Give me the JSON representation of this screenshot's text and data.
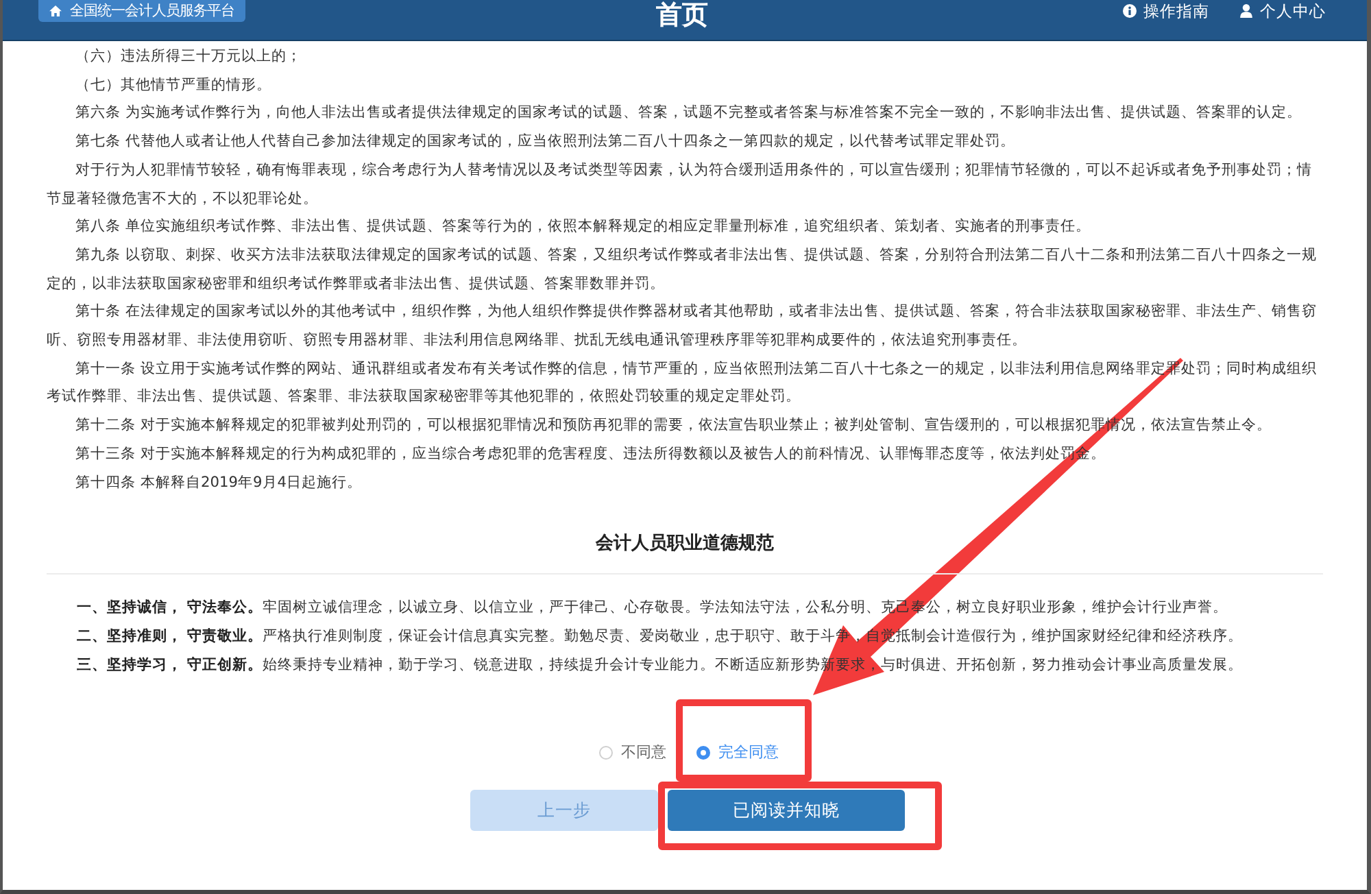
{
  "header": {
    "platform": "全国统一会计人员服务平台",
    "title": "首页",
    "links": [
      {
        "label": "操作指南",
        "kind": "guide"
      },
      {
        "label": "个人中心",
        "kind": "account"
      }
    ]
  },
  "interpretation": {
    "paragraphs": [
      "（六）违法所得三十万元以上的；",
      "（七）其他情节严重的情形。",
      "第六条 为实施考试作弊行为，向他人非法出售或者提供法律规定的国家考试的试题、答案，试题不完整或者答案与标准答案不完全一致的，不影响非法出售、提供试题、答案罪的认定。",
      "第七条 代替他人或者让他人代替自己参加法律规定的国家考试的，应当依照刑法第二百八十四条之一第四款的规定，以代替考试罪定罪处罚。",
      "对于行为人犯罪情节较轻，确有悔罪表现，综合考虑行为人替考情况以及考试类型等因素，认为符合缓刑适用条件的，可以宣告缓刑；犯罪情节轻微的，可以不起诉或者免予刑事处罚；情节显著轻微危害不大的，不以犯罪论处。",
      "第八条 单位实施组织考试作弊、非法出售、提供试题、答案等行为的，依照本解释规定的相应定罪量刑标准，追究组织者、策划者、实施者的刑事责任。",
      "第九条 以窃取、刺探、收买方法非法获取法律规定的国家考试的试题、答案，又组织考试作弊或者非法出售、提供试题、答案，分别符合刑法第二百八十二条和刑法第二百八十四条之一规定的，以非法获取国家秘密罪和组织考试作弊罪或者非法出售、提供试题、答案罪数罪并罚。",
      "第十条 在法律规定的国家考试以外的其他考试中，组织作弊，为他人组织作弊提供作弊器材或者其他帮助，或者非法出售、提供试题、答案，符合非法获取国家秘密罪、非法生产、销售窃听、窃照专用器材罪、非法使用窃听、窃照专用器材罪、非法利用信息网络罪、扰乱无线电通讯管理秩序罪等犯罪构成要件的，依法追究刑事责任。",
      "第十一条 设立用于实施考试作弊的网站、通讯群组或者发布有关考试作弊的信息，情节严重的，应当依照刑法第二百八十七条之一的规定，以非法利用信息网络罪定罪处罚；同时构成组织考试作弊罪、非法出售、提供试题、答案罪、非法获取国家秘密罪等其他犯罪的，依照处罚较重的规定定罪处罚。",
      "第十二条 对于实施本解释规定的犯罪被判处刑罚的，可以根据犯罪情况和预防再犯罪的需要，依法宣告职业禁止；被判处管制、宣告缓刑的，可以根据犯罪情况，依法宣告禁止令。",
      "第十三条 对于实施本解释规定的行为构成犯罪的，应当综合考虑犯罪的危害程度、违法所得数额以及被告人的前科情况、认罪悔罪态度等，依法判处罚金。",
      "第十四条 本解释自2019年9月4日起施行。"
    ]
  },
  "code_of_ethics": {
    "title": "会计人员职业道德规范",
    "principles": [
      "**一、坚持诚信， 守法奉公。**牢固树立诚信理念，以诚立身、以信立业，严于律己、心存敬畏。学法知法守法，公私分明、克己奉公，树立良好职业形象，维护会计行业声誉。",
      "**二、坚持准则， 守责敬业。**严格执行准则制度，保证会计信息真实完整。勤勉尽责、爱岗敬业，忠于职守、敢于斗争，自觉抵制会计造假行为，维护国家财经纪律和经济秩序。",
      "**三、坚持学习， 守正创新。**始终秉持专业精神，勤于学习、锐意进取，持续提升会计专业能力。不断适应新形势新要求，与时俱进、开拓创新，努力推动会计事业高质量发展。"
    ]
  },
  "agreement": {
    "options": [
      {
        "label": "不同意",
        "selected": false
      },
      {
        "label": "完全同意",
        "selected": true
      }
    ]
  },
  "buttons": [
    {
      "label": "上一步",
      "kind": "secondary"
    },
    {
      "label": "已阅读并知晓",
      "kind": "primary"
    }
  ]
}
